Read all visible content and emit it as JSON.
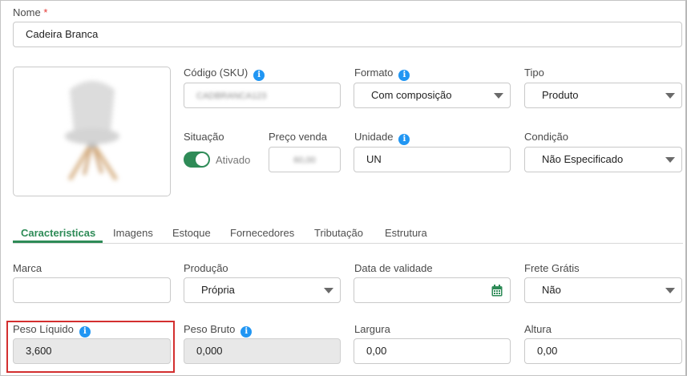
{
  "nome": {
    "label": "Nome",
    "required_mark": "*",
    "value": "Cadeira Branca"
  },
  "sku": {
    "label": "Código (SKU)",
    "value": "CADBRANCA123"
  },
  "formato": {
    "label": "Formato",
    "value": "Com composição"
  },
  "tipo": {
    "label": "Tipo",
    "value": "Produto"
  },
  "situacao": {
    "label": "Situação",
    "toggle_label": "Ativado",
    "enabled": true
  },
  "preco_venda": {
    "label": "Preço venda",
    "value": "60,00"
  },
  "unidade": {
    "label": "Unidade",
    "value": "UN"
  },
  "condicao": {
    "label": "Condição",
    "value": "Não Especificado"
  },
  "tabs": [
    {
      "label": "Caracteristicas",
      "active": true
    },
    {
      "label": "Imagens"
    },
    {
      "label": "Estoque"
    },
    {
      "label": "Fornecedores"
    },
    {
      "label": "Tributação"
    },
    {
      "label": "Estrutura"
    }
  ],
  "marca": {
    "label": "Marca",
    "value": ""
  },
  "producao": {
    "label": "Produção",
    "value": "Própria"
  },
  "data_validade": {
    "label": "Data de validade",
    "value": ""
  },
  "frete_gratis": {
    "label": "Frete Grátis",
    "value": "Não"
  },
  "peso_liquido": {
    "label": "Peso Líquido",
    "value": "3,600"
  },
  "peso_bruto": {
    "label": "Peso Bruto",
    "value": "0,000"
  },
  "largura": {
    "label": "Largura",
    "value": "0,00"
  },
  "altura": {
    "label": "Altura",
    "value": "0,00"
  },
  "icons": {
    "info": "info-icon",
    "calendar": "calendar-icon",
    "dropdown": "chevron-down-icon"
  },
  "colors": {
    "accent": "#2e8b57",
    "info": "#2196f3",
    "highlight": "#d32f2f",
    "required": "#e53935"
  }
}
